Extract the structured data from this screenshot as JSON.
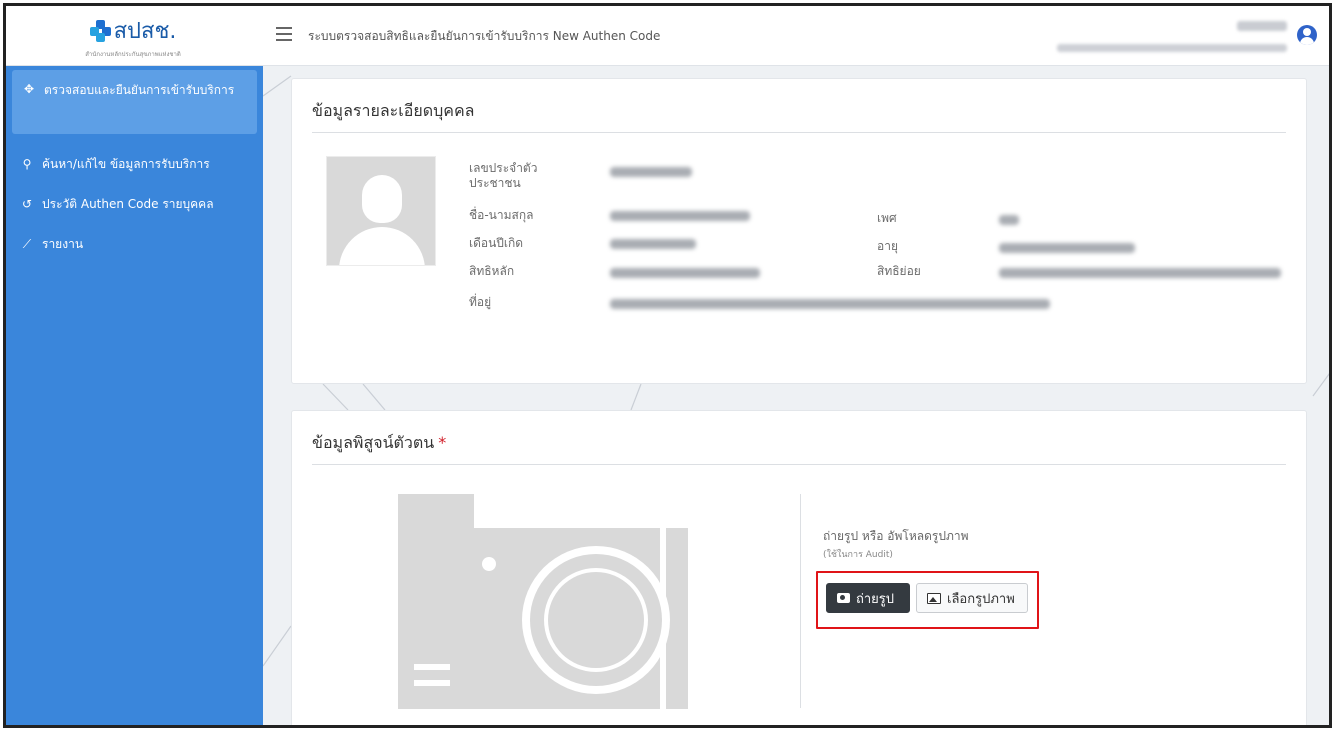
{
  "header": {
    "logo_text": "สปสช.",
    "logo_subtitle": "สำนักงานหลักประกันสุขภาพแห่งชาติ",
    "app_title": "ระบบตรวจสอบสิทธิและยืนยันการเข้ารับบริการ New Authen Code",
    "menu_icon": "hamburger-icon",
    "user_icon": "user-circle-icon"
  },
  "sidebar": {
    "items": [
      {
        "icon": "crosshair-icon",
        "icon_glyph": "✥",
        "label": "ตรวจสอบและยืนยันการเข้ารับบริการ",
        "active": true
      },
      {
        "icon": "search-icon",
        "icon_glyph": "⚲",
        "label": "ค้นหา/แก้ไข ข้อมูลการรับบริการ",
        "active": false
      },
      {
        "icon": "history-icon",
        "icon_glyph": "↺",
        "label": "ประวัติ Authen Code รายบุคคล",
        "active": false
      },
      {
        "icon": "chart-line-icon",
        "icon_glyph": "⟋",
        "label": "รายงาน",
        "active": false
      }
    ]
  },
  "person_section": {
    "title": "ข้อมูลรายละเอียดบุคคล",
    "labels": {
      "citizen_id": "เลขประจำตัวประชาชน",
      "name": "ชื่อ-นามสกุล",
      "gender": "เพศ",
      "birth": "เดือนปีเกิด",
      "age": "อายุ",
      "main_right": "สิทธิหลัก",
      "sub_right": "สิทธิย่อย",
      "address": "ที่อยู่"
    }
  },
  "identity_section": {
    "title": "ข้อมูลพิสูจน์ตัวตน",
    "required_mark": "*",
    "upload_title": "ถ่ายรูป หรือ อัพโหลดรูปภาพ",
    "upload_subtitle": "(ใช้ในการ Audit)",
    "take_photo_label": "ถ่ายรูป",
    "choose_image_label": "เลือกรูปภาพ"
  },
  "colors": {
    "sidebar_bg": "#3a86db",
    "sidebar_active": "#5d9fe6",
    "highlight_border": "#e01418",
    "dark_button": "#343a40",
    "required": "#d21f2a"
  }
}
